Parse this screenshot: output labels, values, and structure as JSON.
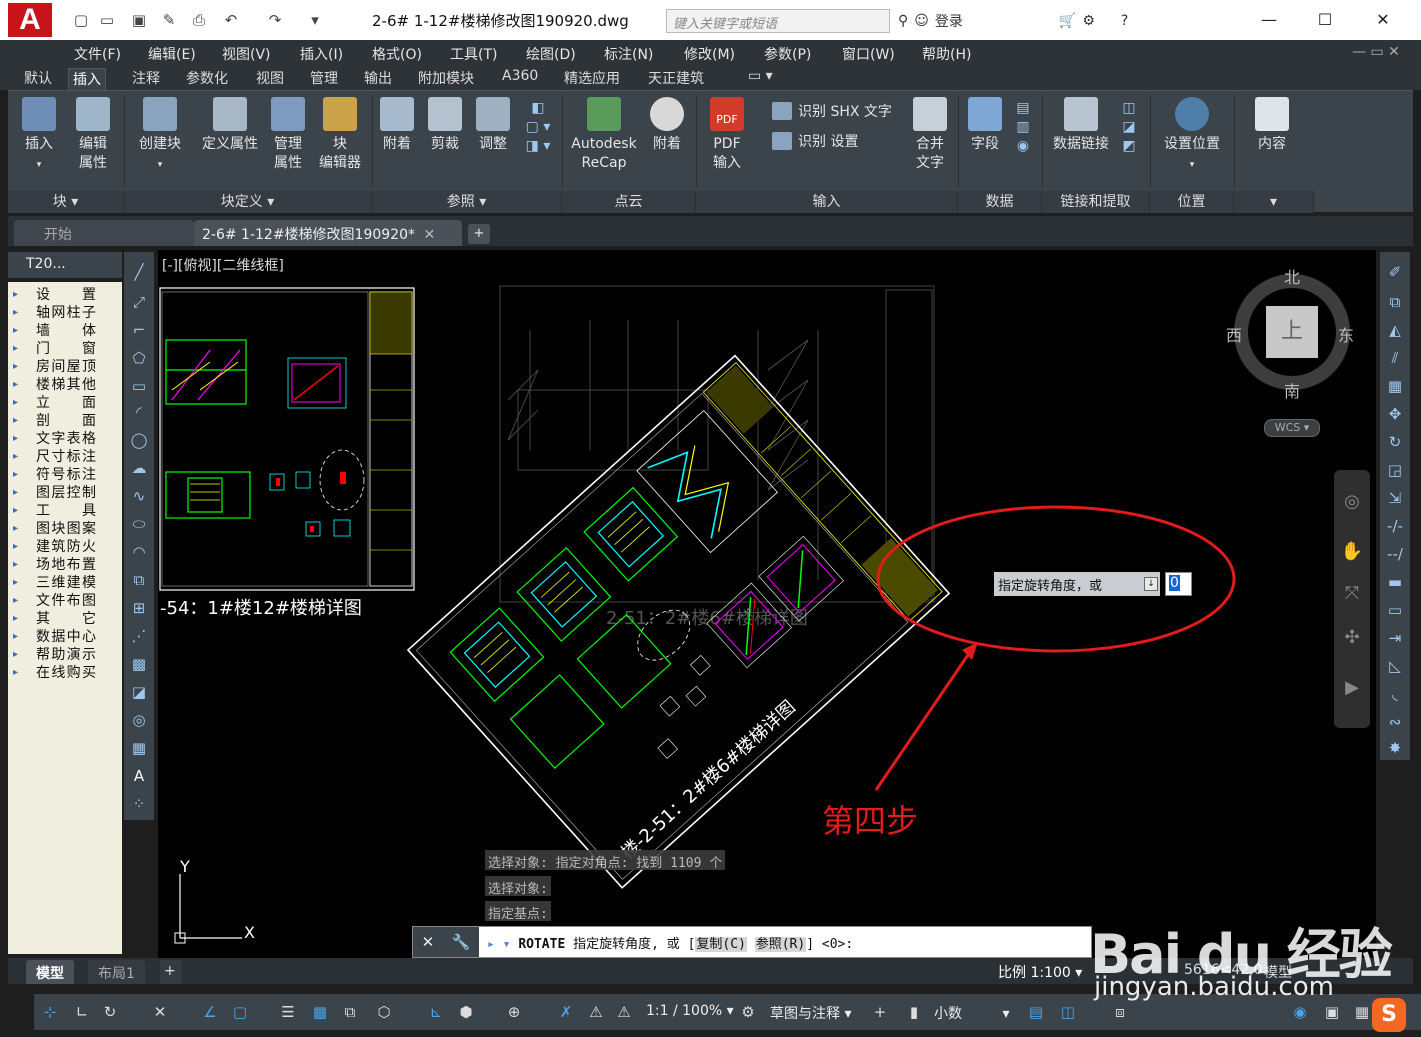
{
  "window": {
    "title": "2-6# 1-12#楼梯修改图190920.dwg",
    "search_placeholder": "键入关键字或短语",
    "login": "登录",
    "help": "?"
  },
  "menu": [
    "文件(F)",
    "编辑(E)",
    "视图(V)",
    "插入(I)",
    "格式(O)",
    "工具(T)",
    "绘图(D)",
    "标注(N)",
    "修改(M)",
    "参数(P)",
    "窗口(W)",
    "帮助(H)"
  ],
  "ribbon_tabs": [
    "默认",
    "插入",
    "注释",
    "参数化",
    "视图",
    "管理",
    "输出",
    "附加模块",
    "A360",
    "精选应用",
    "天正建筑"
  ],
  "active_ribbon_tab": "插入",
  "ribbon": {
    "buttons": {
      "insert": "插入",
      "edit_attr_1": "编辑",
      "edit_attr_2": "属性",
      "create_block": "创建块",
      "define_attr": "定义属性",
      "manage_attr_1": "管理",
      "manage_attr_2": "属性",
      "block_editor_1": "块",
      "block_editor_2": "编辑器",
      "attach": "附着",
      "clip": "剪裁",
      "adjust": "调整",
      "recap_1": "Autodesk",
      "recap_2": "ReCap",
      "attach_cloud": "附着",
      "pdf_import_1": "PDF",
      "pdf_import_2": "输入",
      "pdf_badge": "PDF",
      "recognize_shx": "识别 SHX 文字",
      "recognize_settings": "识别 设置",
      "combine_text_1": "合并",
      "combine_text_2": "文字",
      "field": "字段",
      "data_link": "数据链接",
      "set_location": "设置位置",
      "content": "内容"
    },
    "panels": [
      "块",
      "块定义",
      "参照",
      "点云",
      "输入",
      "数据",
      "链接和提取",
      "位置"
    ]
  },
  "file_tabs": {
    "start": "开始",
    "document": "2-6# 1-12#楼梯修改图190920*",
    "add": "+"
  },
  "palette": {
    "title": "T20...",
    "items": [
      "设置",
      "轴网柱子",
      "墙体",
      "门窗",
      "房间屋顶",
      "楼梯其他",
      "立面",
      "剖面",
      "文字表格",
      "尺寸标注",
      "符号标注",
      "图层控制",
      "工具",
      "图块图案",
      "建筑防火",
      "场地布置",
      "三维建模",
      "文件布图",
      "其它",
      "数据中心",
      "帮助演示",
      "在线购买"
    ]
  },
  "viewport": {
    "label": "[-][俯视][二维线框]",
    "viewcube": {
      "north": "北",
      "south": "南",
      "east": "东",
      "west": "西",
      "face": "上"
    },
    "wcs": "WCS",
    "drawing_title_left": "-54：1#楼12#楼梯详图",
    "drawing_title_rotated": "楼-2-51：2#楼6#楼梯详图",
    "drawing_title_ghost": "2-51：2#楼6#楼梯详图",
    "ucs_y": "Y",
    "ucs_x": "X"
  },
  "dynamic_input": {
    "prompt": "指定旋转角度，或",
    "value": "0"
  },
  "annotation": {
    "label": "第四步",
    "color": "#e21b1b"
  },
  "command_history": [
    "选择对象: 指定对角点: 找到 1109 个",
    "选择对象:",
    "指定基点:"
  ],
  "command_line": {
    "command": "ROTATE",
    "prompt": "指定旋转角度, 或 [",
    "option1": "复制(C)",
    "option2": "参照(R)",
    "suffix": "] <0>:"
  },
  "layout_tabs": {
    "model": "模型",
    "layout1": "布局1",
    "add": "+"
  },
  "status": {
    "scale": "比例 1:100",
    "coords": "5616<42,0",
    "space": "模型",
    "annotation_scale": "1:1 / 100%",
    "workspace": "草图与注释",
    "units": "小数"
  },
  "watermark": {
    "logo": "Bai du 经验",
    "url": "jingyan.baidu.com",
    "sogou": "S"
  }
}
